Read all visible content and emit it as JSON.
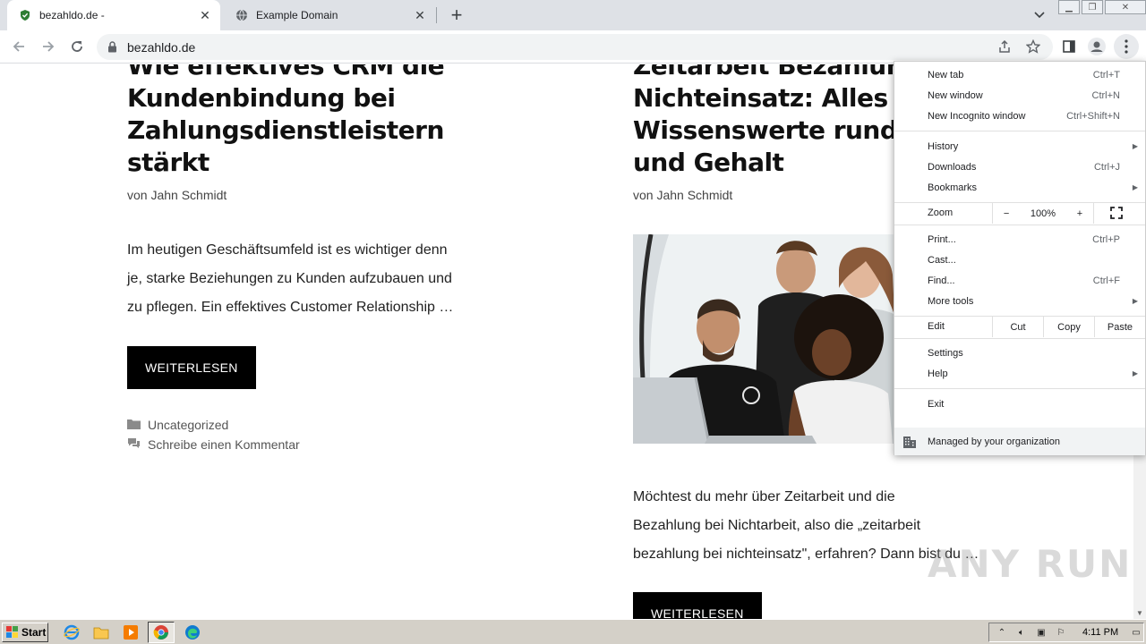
{
  "tabs": [
    {
      "title": "bezahldo.de -",
      "active": true,
      "icon": "shield-favicon"
    },
    {
      "title": "Example Domain",
      "active": false,
      "icon": "globe-favicon"
    }
  ],
  "toolbar": {
    "url": "bezahldo.de"
  },
  "page": {
    "left_post": {
      "title_lines": [
        "Wie effektives CRM die",
        "Kundenbindung bei",
        "Zahlungsdienstleistern",
        "stärkt"
      ],
      "byline_prefix": "von",
      "author": "Jahn Schmidt",
      "excerpt_lines": [
        "Im heutigen Geschäftsumfeld ist es wichtiger denn",
        "je, starke Beziehungen zu Kunden aufzubauen und",
        "zu pflegen. Ein effektives Customer Relationship …"
      ],
      "button": "WEITERLESEN",
      "category": "Uncategorized",
      "comment": "Schreibe einen Kommentar"
    },
    "right_post": {
      "title_lines": [
        "Zeitarbeit Bezahlung",
        "Nichteinsatz: Alles",
        "Wissenswerte rund u",
        "und Gehalt"
      ],
      "byline_prefix": "von",
      "author": "Jahn Schmidt",
      "excerpt_lines": [
        "Möchtest du mehr über Zeitarbeit und die",
        "Bezahlung bei Nichtarbeit, also die „zeitarbeit",
        "bezahlung bei nichteinsatz\", erfahren? Dann bist du …"
      ],
      "button": "WEITERLESEN"
    }
  },
  "menu": {
    "new_tab": {
      "label": "New tab",
      "shortcut": "Ctrl+T"
    },
    "new_window": {
      "label": "New window",
      "shortcut": "Ctrl+N"
    },
    "new_incognito": {
      "label": "New Incognito window",
      "shortcut": "Ctrl+Shift+N"
    },
    "history": {
      "label": "History"
    },
    "downloads": {
      "label": "Downloads",
      "shortcut": "Ctrl+J"
    },
    "bookmarks": {
      "label": "Bookmarks"
    },
    "zoom": {
      "label": "Zoom",
      "minus": "−",
      "value": "100%",
      "plus": "+"
    },
    "print": {
      "label": "Print...",
      "shortcut": "Ctrl+P"
    },
    "cast": {
      "label": "Cast..."
    },
    "find": {
      "label": "Find...",
      "shortcut": "Ctrl+F"
    },
    "more_tools": {
      "label": "More tools"
    },
    "edit": {
      "label": "Edit",
      "cut": "Cut",
      "copy": "Copy",
      "paste": "Paste"
    },
    "settings": {
      "label": "Settings"
    },
    "help": {
      "label": "Help"
    },
    "exit": {
      "label": "Exit"
    },
    "managed": {
      "label": "Managed by your organization"
    }
  },
  "watermark": "ANY RUN",
  "taskbar": {
    "start": "Start",
    "time": "4:11 PM"
  }
}
